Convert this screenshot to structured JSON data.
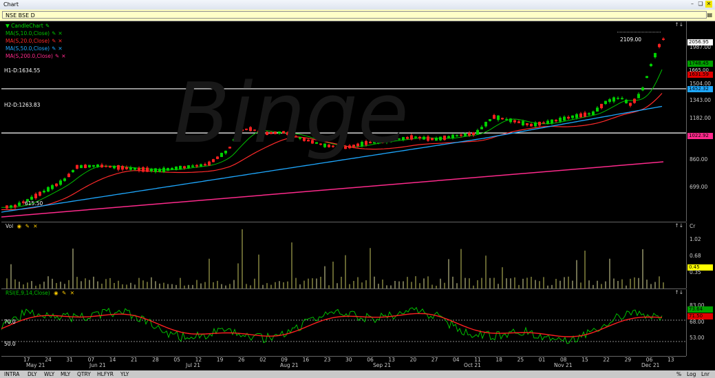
{
  "window": {
    "title": "Chart"
  },
  "symbol": {
    "value": "NSE BSE D"
  },
  "legend": [
    {
      "label": "CandleChart",
      "color": "#00e000",
      "prefix": "▼ "
    },
    {
      "label": "MA(S,10.0,Close)",
      "color": "#00c000"
    },
    {
      "label": "MA(S,20.0,Close)",
      "color": "#ff2a2a"
    },
    {
      "label": "MA(S,50.0,Close)",
      "color": "#1ea8ff"
    },
    {
      "label": "MA(S,200.0,Close)",
      "color": "#ff2a8c"
    }
  ],
  "hlines": {
    "h1": "H1-D:1634.55",
    "h2": "H2-D:1263.83"
  },
  "annotations": {
    "high": "2109.00",
    "low": "615.50",
    "watermark": "Binge"
  },
  "price_axis": {
    "ticks": [
      "1987.00",
      "1504.00",
      "1343.00",
      "1182.00",
      "860.00",
      "699.00"
    ],
    "tags": [
      {
        "text": "2056.95",
        "bg": "#ffffff",
        "fg": "#000000"
      },
      {
        "text": "1748.45",
        "bg": "#00a000",
        "fg": "#000000"
      },
      {
        "text": "1665.00",
        "bg": "#000000",
        "fg": "#dddddd"
      },
      {
        "text": "1631.59",
        "bg": "#e00000",
        "fg": "#000000"
      },
      {
        "text": "1452.32",
        "bg": "#1ea8ff",
        "fg": "#000000"
      },
      {
        "text": "1022.92",
        "bg": "#ff2a8c",
        "fg": "#000000"
      }
    ]
  },
  "vol_pane": {
    "label": "Vol",
    "unit": "Cr",
    "ticks": [
      "1.02",
      "0.68",
      "0.35"
    ],
    "tag": "0.45"
  },
  "rsi_pane": {
    "label": "RSI(E,9,14,Close)",
    "ticks": [
      "83.00",
      "68.00",
      "53.00"
    ],
    "tags": [
      "73.64",
      "71.50"
    ],
    "left_levels": [
      "70.0",
      "50.0"
    ]
  },
  "x_axis": {
    "days": [
      "17",
      "24",
      "31",
      "07",
      "14",
      "21",
      "28",
      "05",
      "12",
      "19",
      "26",
      "02",
      "09",
      "16",
      "23",
      "30",
      "06",
      "13",
      "20",
      "27",
      "04",
      "11",
      "18",
      "25",
      "01",
      "08",
      "15",
      "22",
      "29",
      "06",
      "13"
    ],
    "months": [
      "May 21",
      "Jun 21",
      "Jul 21",
      "Aug 21",
      "Sep 21",
      "Oct 21",
      "Nov 21",
      "Dec 21"
    ]
  },
  "bottom": {
    "tabs": [
      "INTRA",
      "DLY",
      "WLY",
      "MLY",
      "QTRY",
      "HLFYR",
      "YLY"
    ],
    "right": [
      "%",
      "Log",
      "Lnr"
    ]
  },
  "colors": {
    "up": "#00d000",
    "down": "#ff2020",
    "ma10": "#00c000",
    "ma20": "#ff2a2a",
    "ma50": "#1ea8ff",
    "ma200": "#ff2a8c",
    "vol": "#c8c860"
  }
}
